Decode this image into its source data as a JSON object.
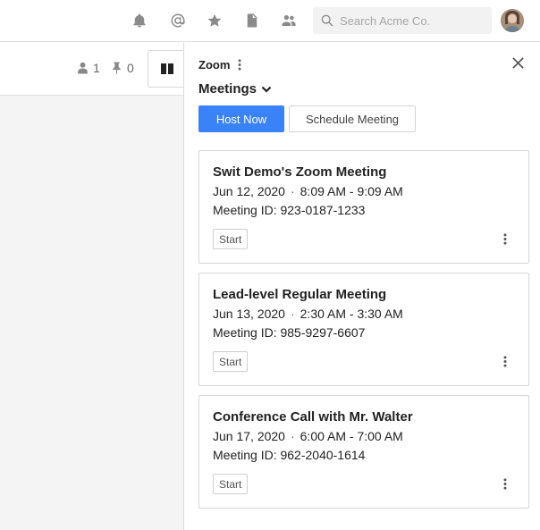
{
  "topbar": {
    "icons": [
      "bell-icon",
      "at-sign-icon",
      "star-icon",
      "document-icon",
      "people-icon"
    ],
    "search_placeholder": "Search Acme Co."
  },
  "left": {
    "members_count": "1",
    "pinned_count": "0"
  },
  "panel": {
    "app_title": "Zoom",
    "section": "Meetings",
    "host_now_label": "Host Now",
    "schedule_label": "Schedule Meeting",
    "meetings": [
      {
        "title": "Swit Demo's Zoom Meeting",
        "date": "Jun 12, 2020",
        "time": "8:09 AM - 9:09 AM",
        "meeting_id": "Meeting ID: 923-0187-1233",
        "start_label": "Start"
      },
      {
        "title": "Lead-level Regular Meeting",
        "date": "Jun 13, 2020",
        "time": "2:30 AM - 3:30 AM",
        "meeting_id": "Meeting ID: 985-9297-6607",
        "start_label": "Start"
      },
      {
        "title": "Conference Call with Mr. Walter",
        "date": "Jun 17, 2020",
        "time": "6:00 AM - 7:00 AM",
        "meeting_id": "Meeting ID: 962-2040-1614",
        "start_label": "Start"
      }
    ],
    "separator": "·"
  },
  "colors": {
    "accent": "#3a82f7",
    "border": "#d7d7d7"
  }
}
